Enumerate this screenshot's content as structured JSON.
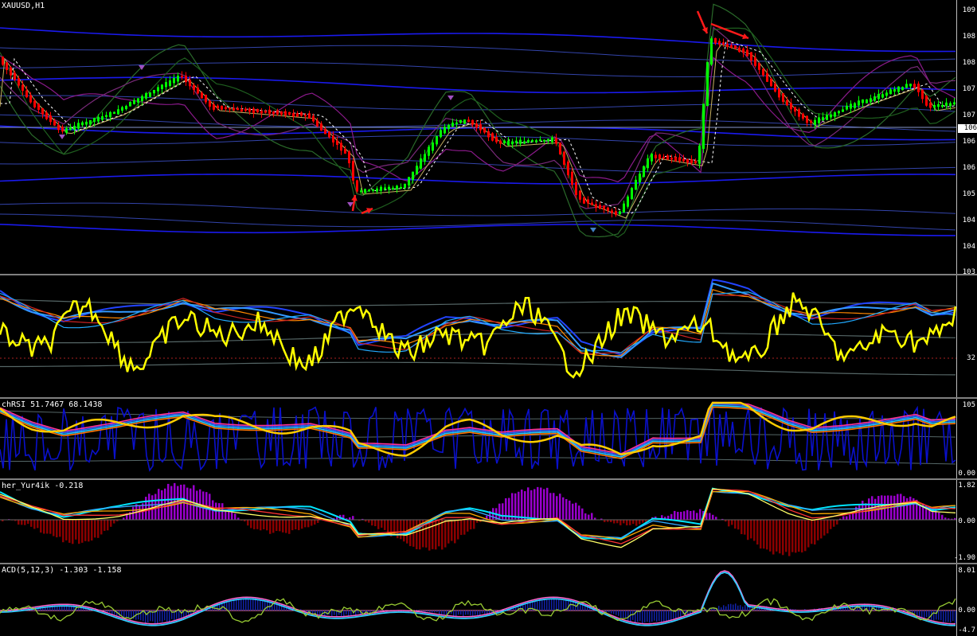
{
  "main": {
    "label": "XAUUSD,H1",
    "ticks": [
      "109",
      "108",
      "108",
      "107",
      "107",
      "106",
      "106",
      "106",
      "105",
      "104",
      "104",
      "103"
    ],
    "price_marker": "106"
  },
  "stoch": {
    "label": "",
    "level": "32"
  },
  "rsi": {
    "label": "chRSI 51.7467 68.1438",
    "ticks": [
      "105",
      "0.00"
    ]
  },
  "fisher": {
    "label": "her_Yur4ik -0.218",
    "ticks": [
      "1.82",
      "0.00",
      "-1.90"
    ]
  },
  "macd": {
    "label": "ACD(5,12,3) -1.303 -1.158",
    "ticks": [
      "8.01",
      "0.00",
      "-4.7"
    ]
  },
  "colors": {
    "bull": "#00ff00",
    "bear": "#ff0000",
    "yellow": "#ffff00",
    "navy": "#0000aa",
    "purple": "#9900cc",
    "maroon": "#8b0000",
    "cyan": "#00e5ff",
    "arrow": "#ff1a1a"
  }
}
